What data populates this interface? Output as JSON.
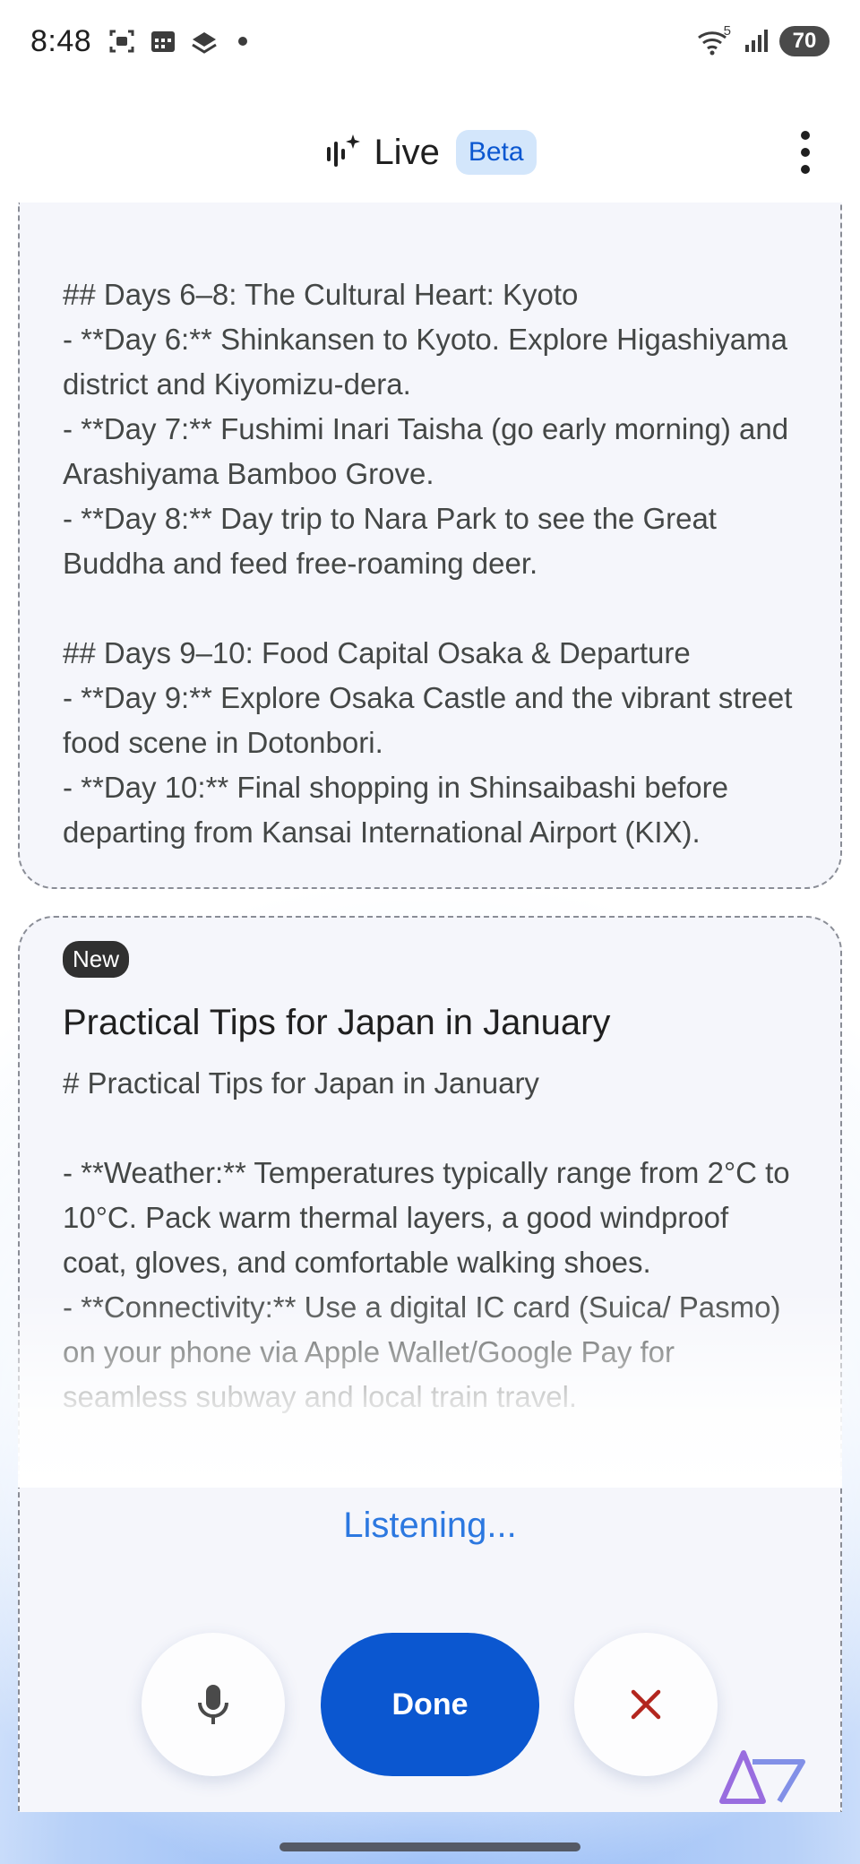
{
  "status_bar": {
    "time": "8:48",
    "battery": "70",
    "wifi_badge": "5",
    "icons": [
      "screenshot-icon",
      "calendar-icon",
      "layers-icon",
      "wifi-icon",
      "signal-icon"
    ]
  },
  "header": {
    "title": "Live",
    "badge": "Beta"
  },
  "card_previous": {
    "text": "## Days 6–8: The Cultural Heart: Kyoto\n- **Day 6:** Shinkansen to Kyoto. Explore Higashiyama district and Kiyomizu-dera.\n- **Day 7:** Fushimi Inari Taisha (go early morning) and Arashiyama Bamboo Grove.\n- **Day 8:** Day trip to Nara Park to see the Great Buddha and feed free-roaming deer.\n\n## Days 9–10: Food Capital Osaka & Departure\n- **Day 9:** Explore Osaka Castle and the vibrant street food scene in Dotonbori.\n- **Day 10:** Final shopping in Shinsaibashi before departing from Kansai International Airport (KIX)."
  },
  "card_new": {
    "badge": "New",
    "title": "Practical Tips for Japan in January",
    "text": "# Practical Tips for Japan in January\n\n- **Weather:** Temperatures typically range from 2°C to 10°C. Pack warm thermal layers, a good windproof coat, gloves, and comfortable walking shoes.\n- **Connectivity:** Use a digital IC card (Suica/ Pasmo) on your phone via Apple Wallet/Google Pay for seamless subway and local train travel."
  },
  "status_text": "Listening...",
  "controls": {
    "done_label": "Done"
  },
  "colors": {
    "primary": "#0b57d0",
    "listening": "#2c78e0",
    "close": "#b3261e"
  }
}
